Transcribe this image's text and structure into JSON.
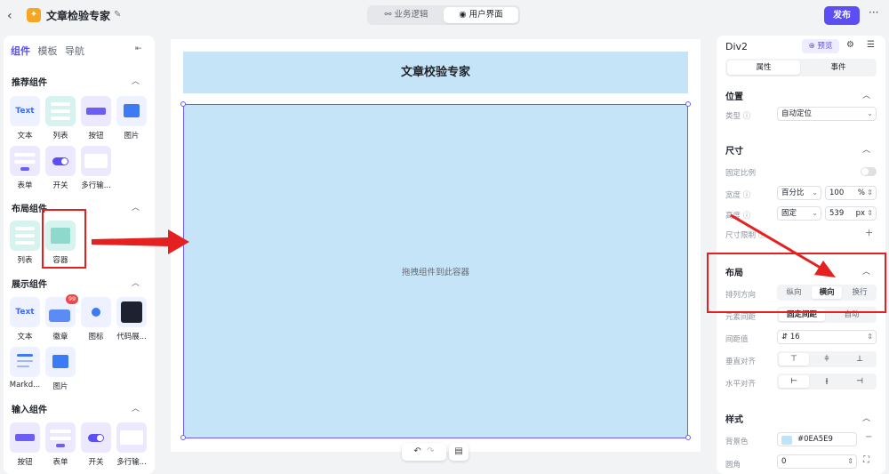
{
  "header": {
    "back_icon": "chevron-left-icon",
    "app_title": "文章检验专家",
    "tabs": [
      {
        "label": "业务逻辑",
        "icon": "flow-icon",
        "active": false
      },
      {
        "label": "用户界面",
        "icon": "palette-icon",
        "active": true
      }
    ],
    "publish_label": "发布",
    "more_label": "···",
    "brand_color": "#5B4EF5"
  },
  "left_panel": {
    "tabs": [
      {
        "label": "组件",
        "active": true
      },
      {
        "label": "模板",
        "active": false
      },
      {
        "label": "导航",
        "active": false
      }
    ],
    "sections": [
      {
        "title": "推荐组件",
        "items": [
          "文本",
          "列表",
          "按钮",
          "图片",
          "表单",
          "开关",
          "多行输..."
        ]
      },
      {
        "title": "布局组件",
        "items": [
          "列表",
          "容器"
        ]
      },
      {
        "title": "展示组件",
        "items": [
          "文本",
          "徽章",
          "图标",
          "代码展...",
          "Markd...",
          "图片"
        ],
        "badge_value": "99"
      },
      {
        "title": "输入组件",
        "items": [
          "按钮",
          "表单",
          "开关",
          "多行输..."
        ]
      }
    ],
    "thumb_text": "Text"
  },
  "canvas": {
    "title_text": "文章校验专家",
    "container_hint": "拖拽组件到此容器",
    "undo_icon": "undo-icon",
    "redo_icon": "redo-icon",
    "doc_icon": "document-icon",
    "container_color": "#C5E4F7"
  },
  "right_panel": {
    "element_name": "Div2",
    "preview_label": "预览",
    "tabs": [
      {
        "label": "属性",
        "active": true
      },
      {
        "label": "事件",
        "active": false
      }
    ],
    "position": {
      "title": "位置",
      "type_label": "类型",
      "type_value": "自动定位"
    },
    "size": {
      "title": "尺寸",
      "fixed_ratio_label": "固定比例",
      "width_label": "宽度",
      "width_mode": "百分比",
      "width_value": "100",
      "width_unit": "%",
      "height_label": "高度",
      "height_mode": "固定",
      "height_value": "539",
      "height_unit": "px",
      "limit_label": "尺寸限制",
      "limit_add": "+"
    },
    "layout": {
      "title": "布局",
      "direction_label": "排列方向",
      "direction_options": [
        "纵向",
        "横向",
        "换行"
      ],
      "direction_selected": "横向",
      "spacing_mode_label": "元素间距",
      "spacing_mode_options": [
        "固定间距",
        "自动"
      ],
      "gap_label": "间距值",
      "gap_value": "16",
      "v_align_label": "垂直对齐",
      "h_align_label": "水平对齐"
    },
    "style": {
      "title": "样式",
      "bg_label": "背景色",
      "bg_value": "#0EA5E9",
      "radius_label": "圆角",
      "radius_value": "0"
    }
  },
  "annotation_color": "#E52020"
}
